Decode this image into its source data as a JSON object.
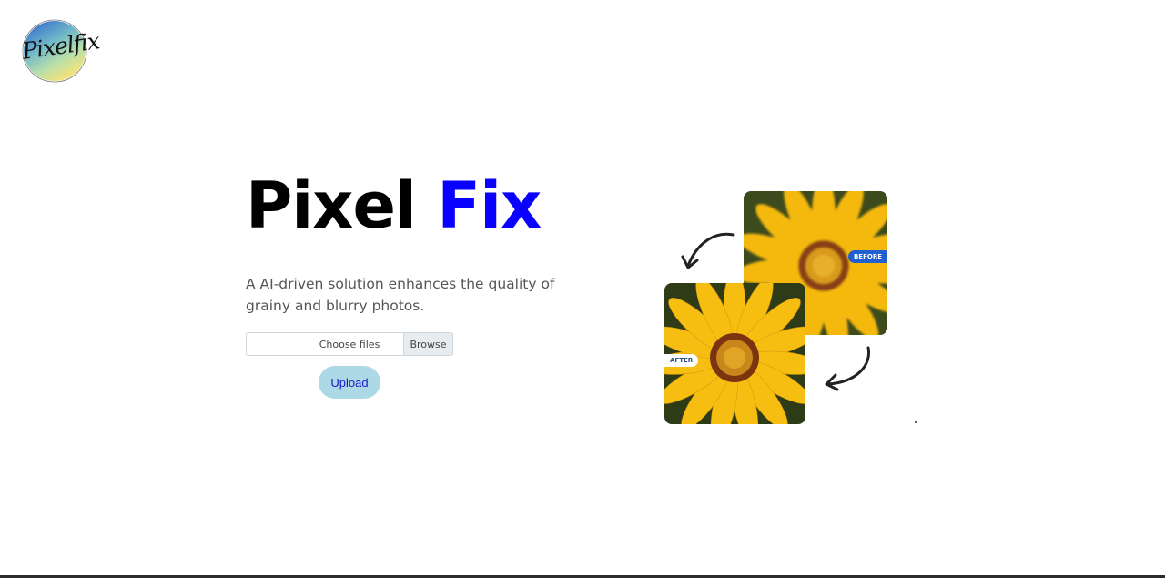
{
  "logo": {
    "text": "Pixelfix",
    "colors": [
      "#3a7bd5",
      "#7ec8a9",
      "#f2e27a"
    ]
  },
  "hero": {
    "title_part1": "Pixel",
    "title_part2": "Fix",
    "title_color1": "#000000",
    "title_color2": "#0a00ff",
    "description": "A AI-driven solution enhances the quality of grainy and blurry photos."
  },
  "file_input": {
    "label": "Choose files",
    "browse_label": "Browse"
  },
  "upload": {
    "label": "Upload",
    "bg_color": "#add8e6"
  },
  "illustration": {
    "before_tag": "BEFORE",
    "after_tag": "AFTER",
    "before_image": "sunflower-blurry",
    "after_image": "sunflower-sharp",
    "arrow_icons": [
      "curved-arrow-icon",
      "curved-arrow-icon"
    ]
  }
}
